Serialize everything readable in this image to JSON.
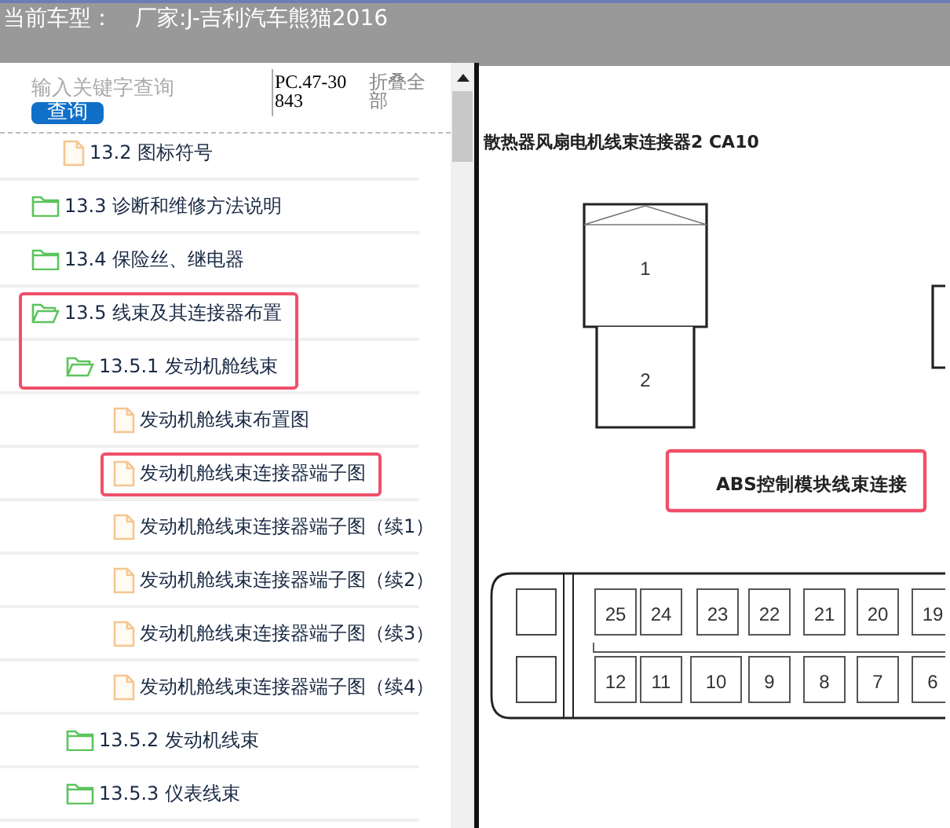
{
  "title_bar": {
    "label": "当前车型：",
    "value": "厂家:J-吉利汽车熊猫2016"
  },
  "search": {
    "placeholder": "输入关键字查询",
    "button": "查询",
    "code": "PC.47-30843",
    "collapse": "折叠全部"
  },
  "tree": [
    {
      "kind": "doc",
      "label": "13.2 图标符号",
      "highlighted": false
    },
    {
      "kind": "folder",
      "label": "13.3 诊断和维修方法说明",
      "expanded": false,
      "highlighted": false
    },
    {
      "kind": "folder",
      "label": "13.4 保险丝、继电器",
      "expanded": false,
      "highlighted": false
    },
    {
      "kind": "folder",
      "label": "13.5 线束及其连接器布置",
      "expanded": true,
      "highlighted": true,
      "children": [
        {
          "kind": "folder",
          "label": "13.5.1 发动机舱线束",
          "expanded": true,
          "highlighted": true,
          "children": [
            {
              "kind": "doc",
              "label": "发动机舱线束布置图",
              "highlighted": false
            },
            {
              "kind": "doc",
              "label": "发动机舱线束连接器端子图",
              "highlighted": true
            },
            {
              "kind": "doc",
              "label": "发动机舱线束连接器端子图（续1）",
              "highlighted": false
            },
            {
              "kind": "doc",
              "label": "发动机舱线束连接器端子图（续2）",
              "highlighted": false
            },
            {
              "kind": "doc",
              "label": "发动机舱线束连接器端子图（续3）",
              "highlighted": false
            },
            {
              "kind": "doc",
              "label": "发动机舱线束连接器端子图（续4）",
              "highlighted": false
            }
          ]
        },
        {
          "kind": "folder",
          "label": "13.5.2 发动机线束",
          "expanded": false,
          "highlighted": false
        },
        {
          "kind": "folder",
          "label": "13.5.3 仪表线束",
          "expanded": false,
          "highlighted": false
        }
      ]
    }
  ],
  "diagram": {
    "heading": "散热器风扇电机线束连接器2  CA10",
    "connector_pins": [
      "1",
      "2"
    ],
    "label": {
      "text": "ABS控制模块线束连接",
      "highlighted": true
    },
    "pin_rows": [
      [
        "25",
        "24",
        "23",
        "22",
        "21",
        "20",
        "19"
      ],
      [
        "12",
        "11",
        "10",
        "9",
        "8",
        "7",
        "6"
      ]
    ]
  }
}
